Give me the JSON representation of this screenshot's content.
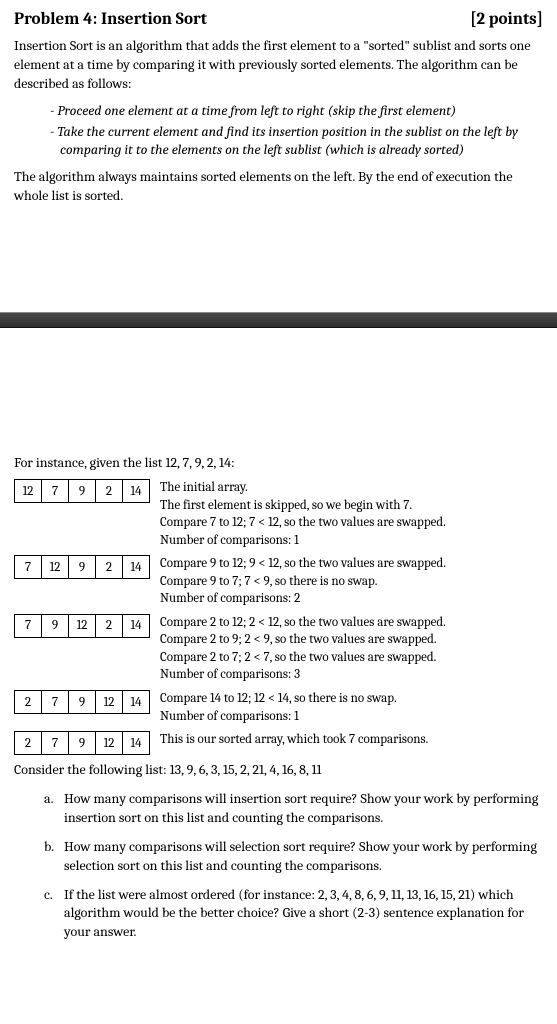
{
  "header": {
    "title": "Problem 4: Insertion Sort",
    "points": "[2 points]"
  },
  "intro": "Insertion Sort is an algorithm that adds the first element to a \"sorted\" sublist and sorts one element at a time by comparing it with previously sorted elements. The algorithm can be described as follows:",
  "bullets": [
    "- Proceed one element at a time from left to right (skip the first element)",
    "- Take the current element and find its insertion position in the sublist on the left by comparing it to the elements on the left sublist (which is already sorted)"
  ],
  "after_bullets": "The algorithm always maintains sorted elements on the left. By the end of execution the whole list is sorted.",
  "example_intro": "For instance, given the list 12, 7, 9, 2, 14:",
  "steps": [
    {
      "arr": [
        "12",
        "7",
        "9",
        "2",
        "14"
      ],
      "lines": [
        "The initial array.",
        "The first element is skipped, so we begin with 7.",
        "Compare 7 to 12; 7 < 12, so the two values are swapped.",
        "Number of comparisons: 1"
      ]
    },
    {
      "arr": [
        "7",
        "12",
        "9",
        "2",
        "14"
      ],
      "lines": [
        "Compare 9 to 12; 9 < 12, so the two values are swapped.",
        "Compare 9 to 7; 7 < 9, so there is no swap.",
        "Number of comparisons: 2"
      ]
    },
    {
      "arr": [
        "7",
        "9",
        "12",
        "2",
        "14"
      ],
      "lines": [
        "Compare 2 to 12; 2 < 12, so the two values are swapped.",
        "Compare 2 to 9; 2 < 9, so the two values are swapped.",
        "Compare 2 to 7; 2 < 7, so the two values are swapped.",
        "Number of comparisons: 3"
      ]
    },
    {
      "arr": [
        "2",
        "7",
        "9",
        "12",
        "14"
      ],
      "lines": [
        "Compare 14 to 12; 12 < 14, so there is no swap.",
        "Number of comparisons: 1"
      ]
    },
    {
      "arr": [
        "2",
        "7",
        "9",
        "12",
        "14"
      ],
      "lines": [
        "This is our sorted array, which took 7 comparisons."
      ]
    }
  ],
  "consider": "Consider the following list: 13, 9, 6, 3, 15, 2, 21, 4, 16, 8, 11",
  "questions": [
    {
      "label": "a.",
      "text": "How many comparisons will insertion sort require? Show your work by performing insertion sort on this list and counting the comparisons."
    },
    {
      "label": "b.",
      "text": "How many comparisons will selection sort require? Show your work by performing selection sort on this list and counting the comparisons."
    },
    {
      "label": "c.",
      "text": "If the list were almost ordered (for instance: 2, 3, 4, 8, 6, 9, 11, 13, 16, 15, 21) which algorithm would be the better choice? Give a short (2-3) sentence explanation for your answer."
    }
  ]
}
